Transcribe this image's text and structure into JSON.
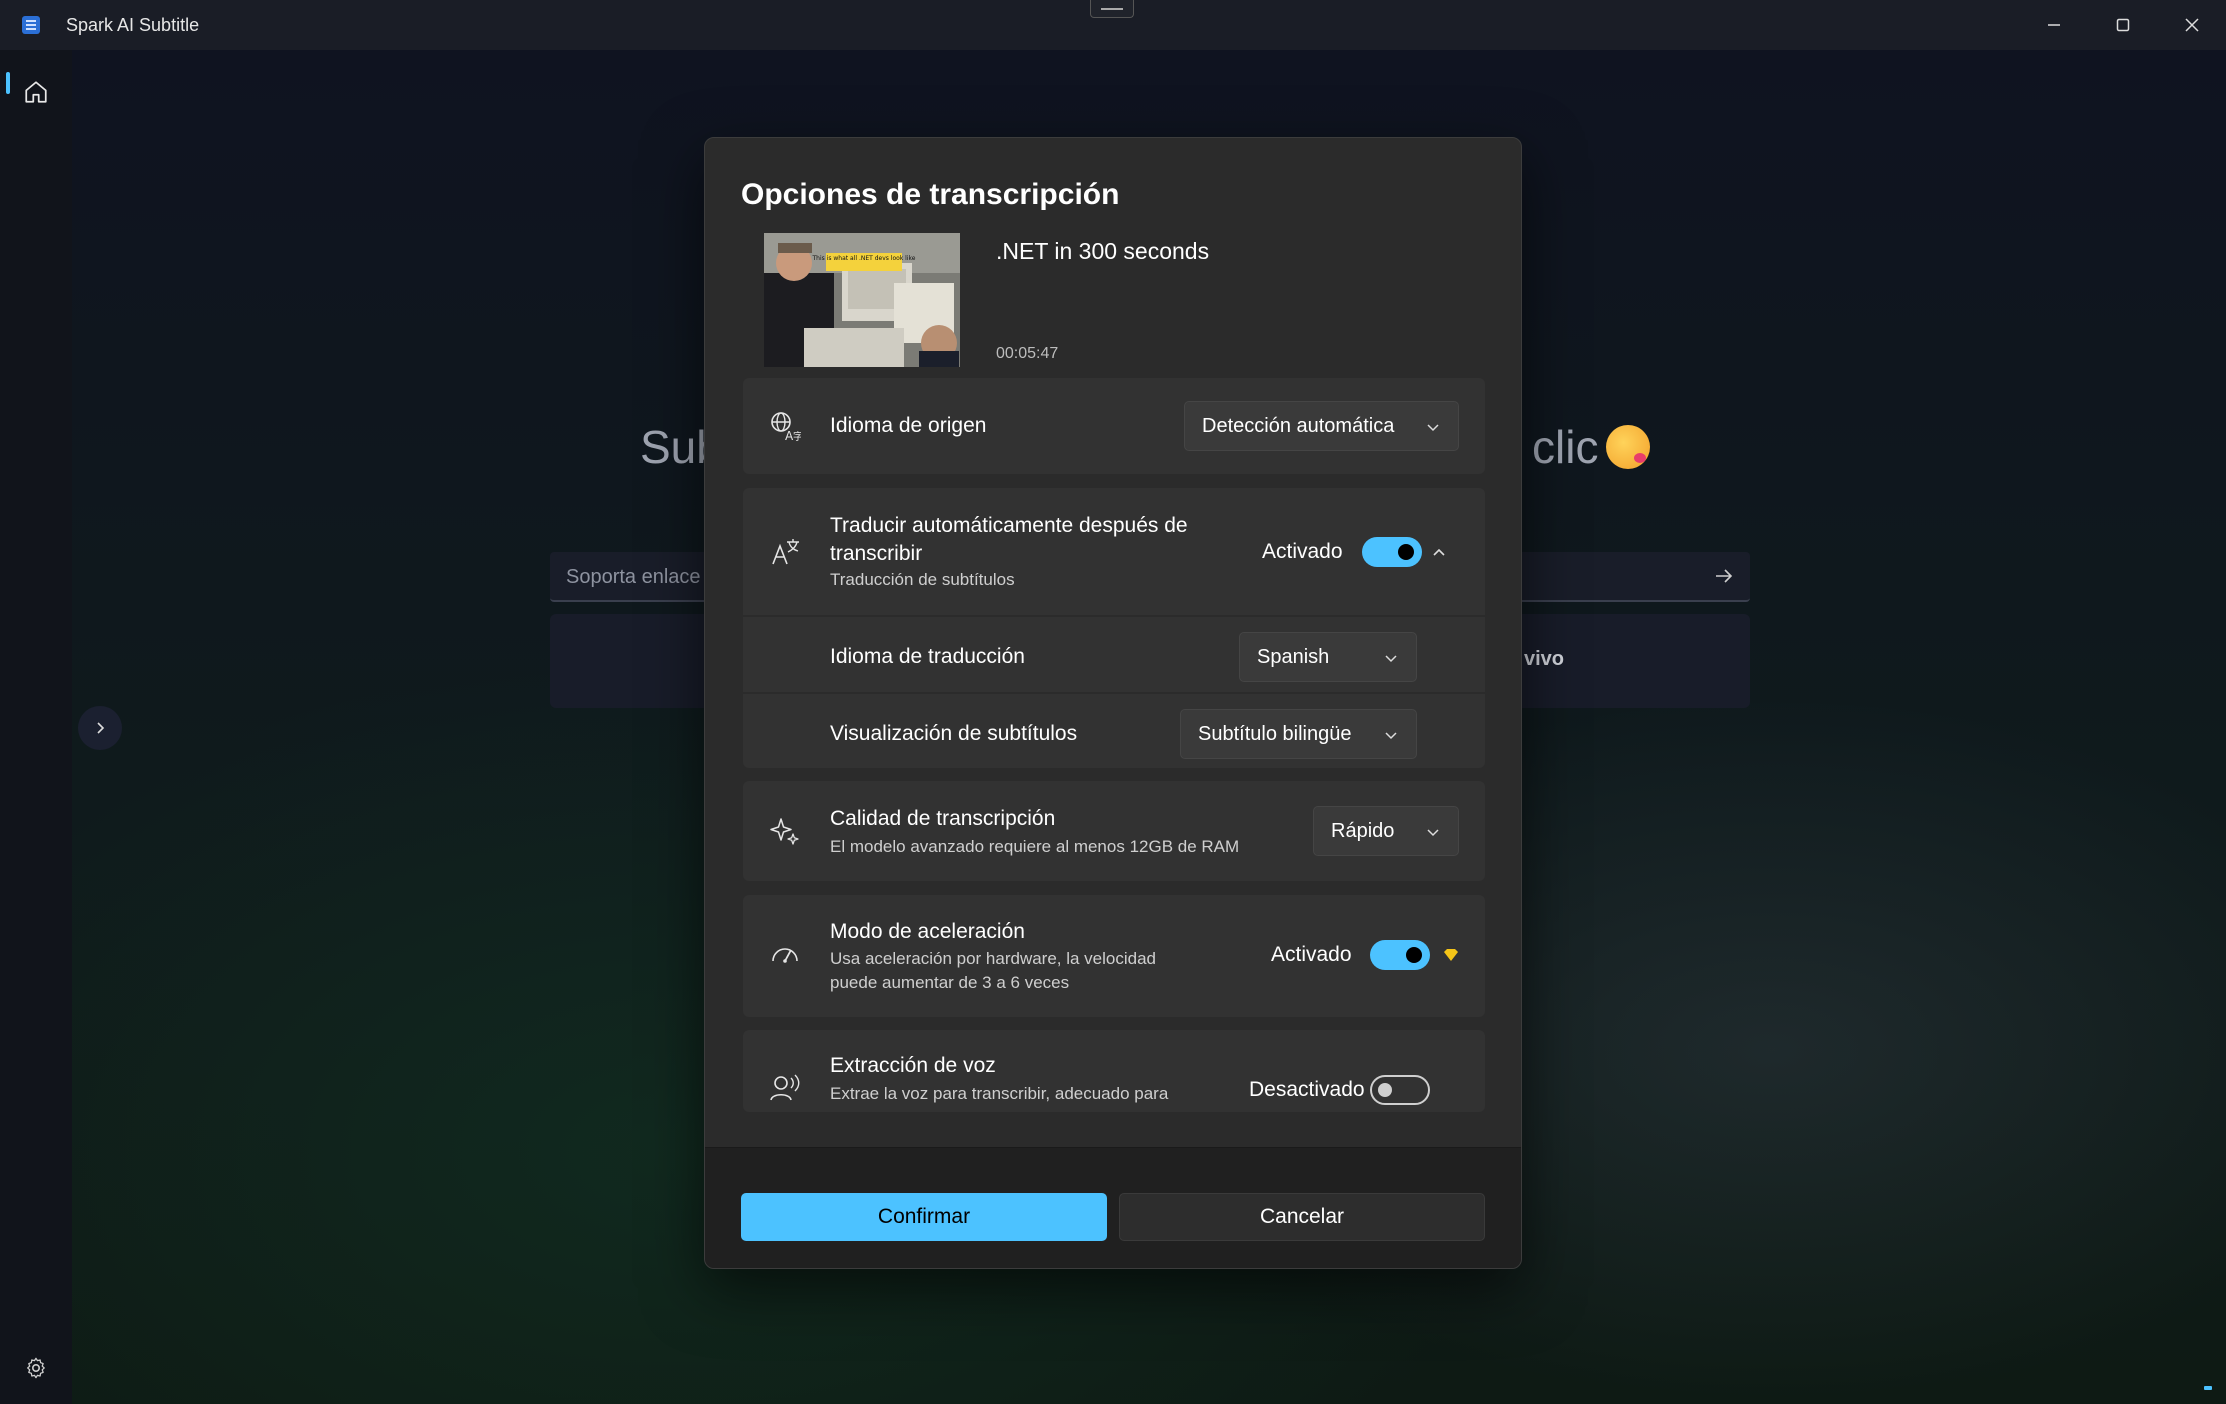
{
  "app": {
    "title": "Spark AI Subtitle"
  },
  "background": {
    "headline_left": "Sub",
    "headline_right": "clic",
    "input_placeholder": "Soporta enlace",
    "card_text": "vivo"
  },
  "dialog": {
    "title": "Opciones de transcripción",
    "video": {
      "title": ".NET in 300 seconds",
      "duration": "00:05:47",
      "thumbnail_caption": "This is what all .NET devs look like"
    },
    "source_language": {
      "label": "Idioma de origen",
      "value": "Detección automática"
    },
    "auto_translate": {
      "label": "Traducir automáticamente después de transcribir",
      "sublabel": "Traducción de subtítulos",
      "state_label": "Activado",
      "enabled": true
    },
    "translation_language": {
      "label": "Idioma de traducción",
      "value": "Spanish"
    },
    "subtitle_display": {
      "label": "Visualización de subtítulos",
      "value": "Subtítulo bilingüe"
    },
    "quality": {
      "label": "Calidad de transcripción",
      "sublabel": "El modelo avanzado requiere al menos 12GB de RAM",
      "value": "Rápido"
    },
    "acceleration": {
      "label": "Modo de aceleración",
      "sublabel": "Usa aceleración por hardware, la velocidad puede aumentar de 3 a 6 veces",
      "state_label": "Activado",
      "enabled": true
    },
    "voice_extraction": {
      "label": "Extracción de voz",
      "sublabel": "Extrae la voz para transcribir, adecuado para",
      "state_label": "Desactivado",
      "enabled": false
    },
    "buttons": {
      "confirm": "Confirmar",
      "cancel": "Cancelar"
    }
  },
  "colors": {
    "accent": "#4cc2ff",
    "dialog_bg": "#2b2b2b",
    "card_bg": "#323232",
    "premium": "#f5c518"
  }
}
